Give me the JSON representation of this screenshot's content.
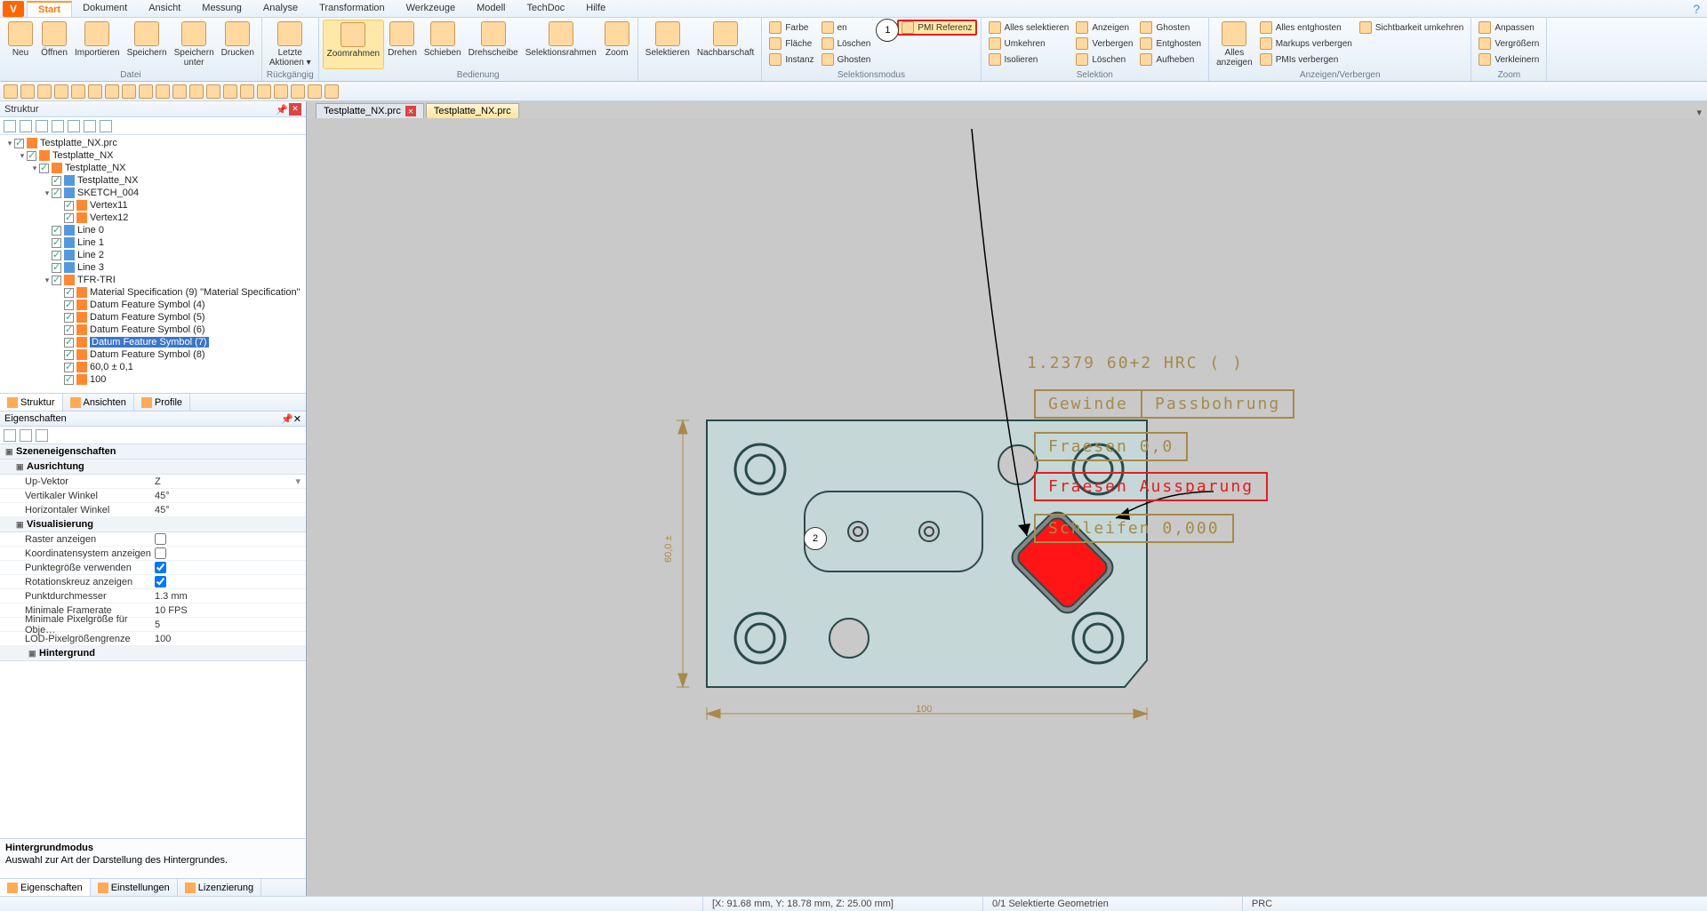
{
  "menu": {
    "tabs": [
      "Start",
      "Dokument",
      "Ansicht",
      "Messung",
      "Analyse",
      "Transformation",
      "Werkzeuge",
      "Modell",
      "TechDoc",
      "Hilfe"
    ],
    "active": 0
  },
  "ribbon": {
    "datei": {
      "label": "Datei",
      "neu": "Neu",
      "offnen": "Öffnen",
      "importieren": "Importieren",
      "speichern": "Speichern",
      "speichern_unter": "Speichern\nunter",
      "drucken": "Drucken"
    },
    "ruckgangig": {
      "label": "Rückgängig",
      "letzte": "Letzte\nAktionen ▾"
    },
    "bedienung": {
      "label": "Bedienung",
      "zoomrahmen": "Zoomrahmen",
      "drehen": "Drehen",
      "schieben": "Schieben",
      "drehscheibe": "Drehscheibe",
      "selektionsrahmen": "Selektionsrahmen",
      "zoom": "Zoom"
    },
    "sel": {
      "selektieren": "Selektieren",
      "nachbarschaft": "Nachbarschaft"
    },
    "selektionsmodus": {
      "label": "Selektionsmodus",
      "farbe": "Farbe",
      "flache": "Fläche",
      "instanz": "Instanz",
      "loschen": "Löschen",
      "ghosten": "Ghosten",
      "pmi": "PMI Referenz"
    },
    "selektion": {
      "label": "Selektion",
      "alles": "Alles selektieren",
      "umkehren": "Umkehren",
      "isolieren": "Isolieren",
      "anzeigen": "Anzeigen",
      "verbergen": "Verbergen",
      "loschen": "Löschen",
      "ghosten": "Ghosten",
      "entghosten": "Entghosten",
      "aufheben": "Aufheben"
    },
    "anz": {
      "label": "Anzeigen/Verbergen",
      "alles_anzeigen": "Alles\nanzeigen",
      "alles_entghosten": "Alles entghosten",
      "markups": "Markups verbergen",
      "pmis": "PMIs verbergen",
      "sichtbarkeit": "Sichtbarkeit umkehren"
    },
    "zoom": {
      "label": "Zoom",
      "anpassen": "Anpassen",
      "vergrossern": "Vergrößern",
      "verkleinern": "Verkleinern"
    }
  },
  "struktur": {
    "title": "Struktur"
  },
  "tree": {
    "items": [
      {
        "indent": 0,
        "exp": "▾",
        "chk": true,
        "icon": "orange",
        "label": "Testplatte_NX.prc"
      },
      {
        "indent": 1,
        "exp": "▾",
        "chk": true,
        "icon": "orange",
        "label": "Testplatte_NX"
      },
      {
        "indent": 2,
        "exp": "▾",
        "chk": true,
        "icon": "orange",
        "label": "Testplatte_NX"
      },
      {
        "indent": 3,
        "exp": "",
        "chk": true,
        "icon": "blue",
        "label": "Testplatte_NX"
      },
      {
        "indent": 3,
        "exp": "▾",
        "chk": true,
        "icon": "blue",
        "label": "SKETCH_004"
      },
      {
        "indent": 4,
        "exp": "",
        "chk": true,
        "icon": "orange",
        "label": "Vertex11"
      },
      {
        "indent": 4,
        "exp": "",
        "chk": true,
        "icon": "orange",
        "label": "Vertex12"
      },
      {
        "indent": 3,
        "exp": "",
        "chk": true,
        "icon": "blue",
        "label": "Line 0"
      },
      {
        "indent": 3,
        "exp": "",
        "chk": true,
        "icon": "blue",
        "label": "Line 1"
      },
      {
        "indent": 3,
        "exp": "",
        "chk": true,
        "icon": "blue",
        "label": "Line 2"
      },
      {
        "indent": 3,
        "exp": "",
        "chk": true,
        "icon": "blue",
        "label": "Line 3"
      },
      {
        "indent": 3,
        "exp": "▾",
        "chk": true,
        "icon": "orange",
        "label": "TFR-TRI"
      },
      {
        "indent": 4,
        "exp": "",
        "chk": true,
        "icon": "orange",
        "label": "Material Specification (9) \"Material Specification\""
      },
      {
        "indent": 4,
        "exp": "",
        "chk": true,
        "icon": "orange",
        "label": "Datum Feature Symbol (4)"
      },
      {
        "indent": 4,
        "exp": "",
        "chk": true,
        "icon": "orange",
        "label": "Datum Feature Symbol (5)"
      },
      {
        "indent": 4,
        "exp": "",
        "chk": true,
        "icon": "orange",
        "label": "Datum Feature Symbol (6)"
      },
      {
        "indent": 4,
        "exp": "",
        "chk": true,
        "icon": "orange",
        "label": "Datum Feature Symbol (7)",
        "selected": true
      },
      {
        "indent": 4,
        "exp": "",
        "chk": true,
        "icon": "orange",
        "label": "Datum Feature Symbol (8)"
      },
      {
        "indent": 4,
        "exp": "",
        "chk": true,
        "icon": "orange",
        "label": "60,0 ± 0,1"
      },
      {
        "indent": 4,
        "exp": "",
        "chk": true,
        "icon": "orange",
        "label": "100"
      }
    ]
  },
  "panel_tabs": {
    "struktur": "Struktur",
    "ansichten": "Ansichten",
    "profile": "Profile"
  },
  "props": {
    "title": "Eigenschaften",
    "cat_scene": "Szeneneigenschaften",
    "cat_ausrichtung": "Ausrichtung",
    "up_vektor": "Up-Vektor",
    "up_vektor_v": "Z",
    "vert_winkel": "Vertikaler Winkel",
    "vert_winkel_v": "45°",
    "horiz_winkel": "Horizontaler Winkel",
    "horiz_winkel_v": "45°",
    "cat_visual": "Visualisierung",
    "raster": "Raster anzeigen",
    "koord": "Koordinatensystem anzeigen",
    "punktgr": "Punktegröße verwenden",
    "rotkreuz": "Rotationskreuz anzeigen",
    "punktdm": "Punktdurchmesser",
    "punktdm_v": "1.3 mm",
    "minfr": "Minimale Framerate",
    "minfr_v": "10 FPS",
    "minpx": "Minimale Pixelgröße für Obje…",
    "minpx_v": "5",
    "lod": "LOD-Pixelgrößengrenze",
    "lod_v": "100",
    "cat_hg": "Hintergrund",
    "help_title": "Hintergrundmodus",
    "help_text": "Auswahl zur Art der Darstellung des Hintergrundes."
  },
  "bottom_tabs": {
    "eig": "Eigenschaften",
    "einst": "Einstellungen",
    "liz": "Lizenzierung"
  },
  "doc_tabs": {
    "t1": "Testplatte_NX.prc",
    "t2": "Testplatte_NX.prc"
  },
  "pmi": {
    "material": "1.2379 60+2 HRC ( )",
    "gewinde": "Gewinde",
    "passbohrung": "Passbohrung",
    "fraesen": "Fraesen 0,0",
    "aussparung": "Fraesen Aussparung",
    "schleifen": "Schleifen 0,000",
    "dim_h": "60,0 ±",
    "dim_w": "100"
  },
  "callout": {
    "c1": "1",
    "c2": "2"
  },
  "status": {
    "coords": "[X: 91.68 mm, Y: 18.78 mm, Z: 25.00 mm]",
    "sel": "0/1 Selektierte Geometrien",
    "fmt": "PRC"
  }
}
